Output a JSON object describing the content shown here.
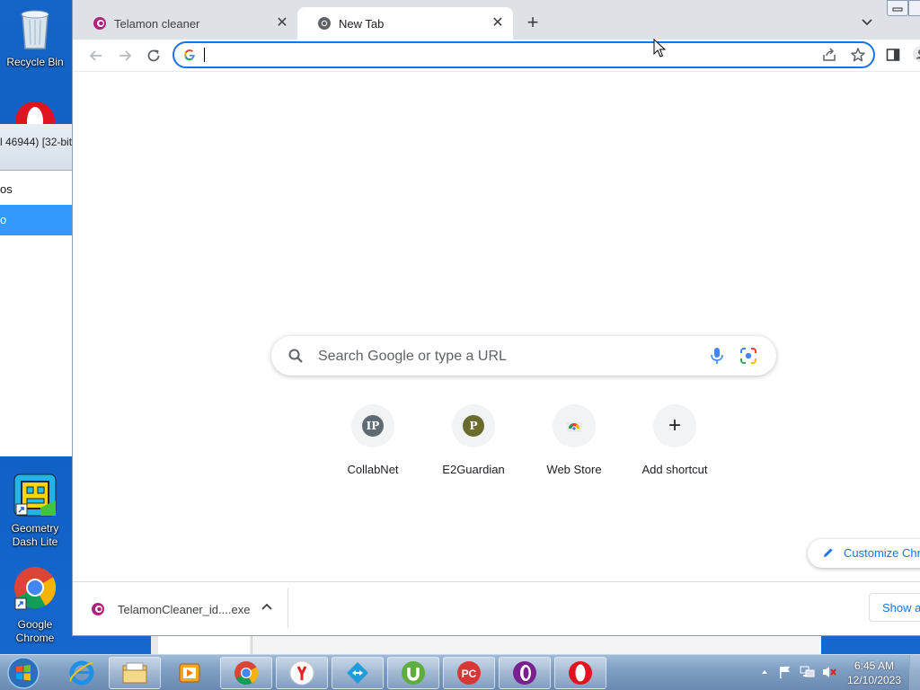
{
  "desktop": {
    "icons": [
      {
        "label": "Recycle Bin"
      },
      {
        "label": "Geometry Dash Lite"
      },
      {
        "label": "Google Chrome"
      }
    ]
  },
  "background_window": {
    "title_fragment": "l 46944) [32-bit]",
    "rows": [
      "os",
      "o"
    ]
  },
  "browser": {
    "tabs": [
      {
        "title": "Telamon cleaner",
        "icon": "telamon-icon"
      },
      {
        "title": "New Tab",
        "icon": "chrome-icon",
        "active": true
      }
    ],
    "omnibox": {
      "value": "",
      "placeholder": ""
    },
    "ntp": {
      "search_placeholder": "Search Google or type a URL",
      "shortcuts": [
        {
          "label": "CollabNet",
          "badge": "IP",
          "color": "#5f6b73"
        },
        {
          "label": "E2Guardian",
          "badge": "P",
          "color": "#6b6b2e"
        },
        {
          "label": "Web Store",
          "badge": "",
          "color": ""
        },
        {
          "label": "Add shortcut",
          "badge": "+",
          "color": ""
        }
      ],
      "customize_label": "Customize Chrome"
    },
    "download_shelf": {
      "file_name": "TelamonCleaner_id....exe",
      "show_all_label": "Show all"
    }
  },
  "taskbar": {
    "clock_time": "6:45 AM",
    "clock_date": "12/10/2023",
    "apps": [
      "internet-explorer",
      "file-explorer",
      "media-player",
      "chrome",
      "yandex",
      "teamviewer",
      "utorrent",
      "pc-cleaner",
      "opera-gx",
      "opera"
    ]
  },
  "colors": {
    "accent": "#1a73e8",
    "desktop": "#1565c8",
    "tabstrip": "#dee1e6",
    "selection": "#3399ff"
  }
}
